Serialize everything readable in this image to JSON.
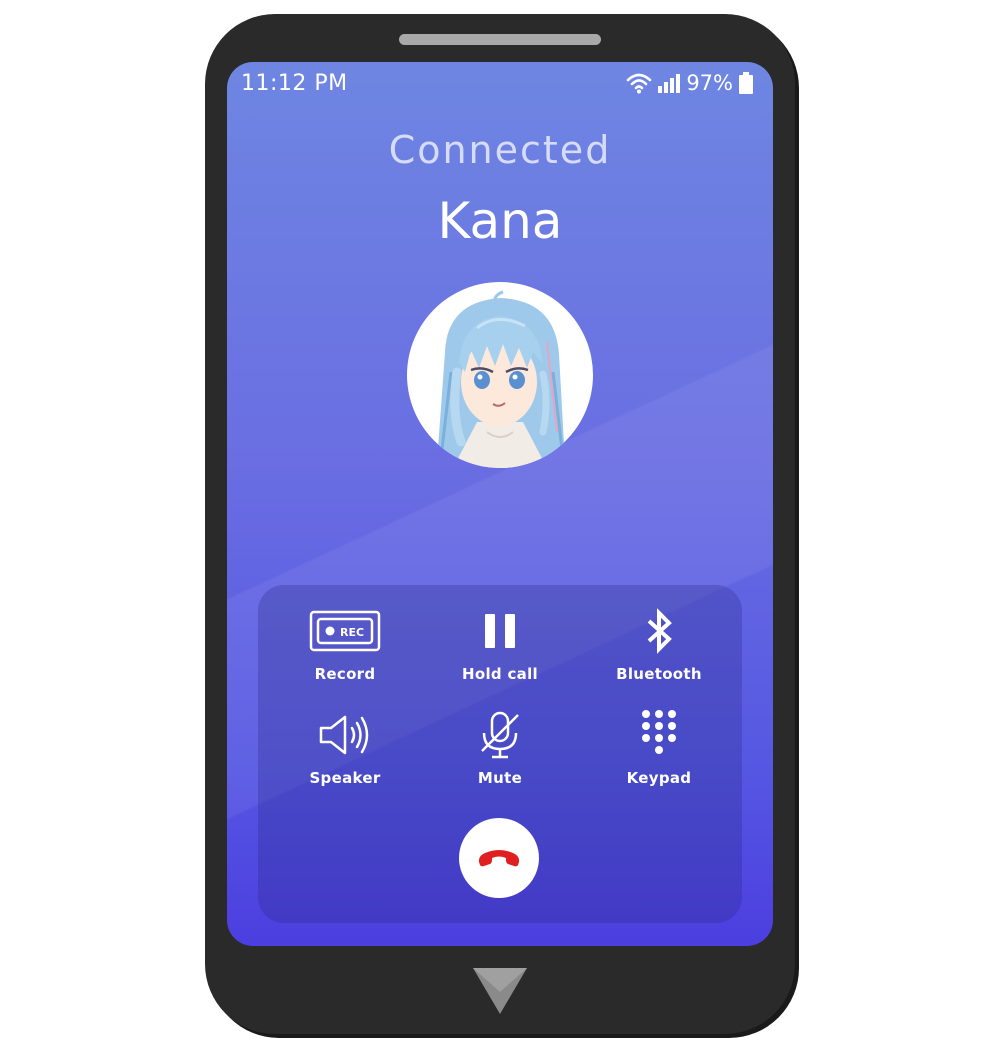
{
  "status_bar": {
    "time": "11:12 PM",
    "battery_percent": "97%",
    "icons": [
      "wifi-icon",
      "signal-icon",
      "battery-icon"
    ]
  },
  "call": {
    "status": "Connected",
    "caller_name": "Kana",
    "avatar": "anime-girl-light-blue-hair"
  },
  "controls": [
    {
      "label": "Record",
      "icon": "record-icon",
      "badge": "REC"
    },
    {
      "label": "Hold call",
      "icon": "pause-icon"
    },
    {
      "label": "Bluetooth",
      "icon": "bluetooth-icon"
    },
    {
      "label": "Speaker",
      "icon": "speaker-icon"
    },
    {
      "label": "Mute",
      "icon": "mic-muted-icon"
    },
    {
      "label": "Keypad",
      "icon": "keypad-icon"
    }
  ],
  "end_call": {
    "icon": "hang-up-icon",
    "color": "#e02020"
  },
  "colors": {
    "phone_body": "#2a2a2a",
    "screen_top": "#6e86e2",
    "screen_bottom": "#4c3ee0",
    "text": "#ffffff"
  }
}
